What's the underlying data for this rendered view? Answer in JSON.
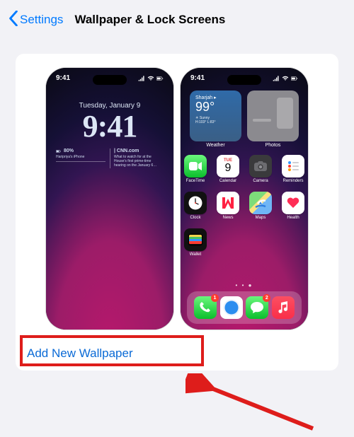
{
  "nav": {
    "back": "Settings",
    "title": "Wallpaper & Lock Screens"
  },
  "addButton": "Add New Wallpaper",
  "statusTime": "9:41",
  "lockScreen": {
    "date": "Tuesday, January 9",
    "time": "9:41",
    "battery": {
      "pct": "80%",
      "device": "Haripriya's iPhone"
    },
    "news": {
      "source": "| CNN.com",
      "text": "What to watch for at the House's first prime-time hearing on the January 6…"
    }
  },
  "homeScreen": {
    "weather": {
      "location": "Sharjah",
      "temp": "99°",
      "cond": "Sunny",
      "hilo": "H:103° L:83°",
      "label": "Weather"
    },
    "photosLabel": "Photos",
    "calendar": {
      "day": "TUE",
      "num": "9"
    },
    "apps": [
      {
        "id": "facetime",
        "label": "FaceTime",
        "icon": "facetime"
      },
      {
        "id": "calendar",
        "label": "Calendar",
        "icon": "calendar"
      },
      {
        "id": "camera",
        "label": "Camera",
        "icon": "camera"
      },
      {
        "id": "reminders",
        "label": "Reminders",
        "icon": "reminders"
      },
      {
        "id": "clock",
        "label": "Clock",
        "icon": "clock"
      },
      {
        "id": "news",
        "label": "News",
        "icon": "news"
      },
      {
        "id": "maps",
        "label": "Maps",
        "icon": "maps"
      },
      {
        "id": "health",
        "label": "Health",
        "icon": "health"
      },
      {
        "id": "wallet",
        "label": "Wallet",
        "icon": "wallet"
      }
    ],
    "pager": "• • ●",
    "dock": [
      {
        "id": "phone",
        "icon": "phone",
        "badge": "1"
      },
      {
        "id": "safari",
        "icon": "safari"
      },
      {
        "id": "messages",
        "icon": "messages",
        "badge": "2"
      },
      {
        "id": "music",
        "icon": "music"
      }
    ]
  }
}
